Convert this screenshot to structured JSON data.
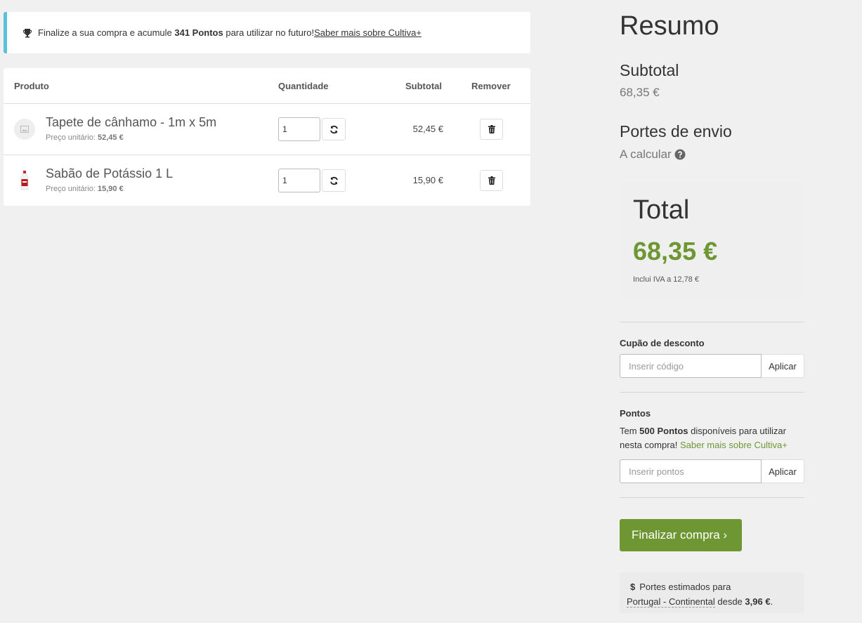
{
  "notice": {
    "icon": "trophy-icon",
    "text_before": "Finalize a sua compra e acumule ",
    "points_bold": "341 Pontos",
    "text_after": " para utilizar no futuro! ",
    "link": "Saber mais sobre Cultiva+"
  },
  "cart": {
    "headers": {
      "product": "Produto",
      "quantity": "Quantidade",
      "subtotal": "Subtotal",
      "remove": "Remover"
    },
    "items": [
      {
        "name": "Tapete de cânhamo - 1m x 5m",
        "unit_label": "Preço unitário: ",
        "unit_price": "52,45 €",
        "quantity": "1",
        "subtotal": "52,45 €",
        "thumb": "image-placeholder-icon"
      },
      {
        "name": "Sabão de Potássio 1 L",
        "unit_label": "Preço unitário: ",
        "unit_price": "15,90 €",
        "quantity": "1",
        "subtotal": "15,90 €",
        "thumb": "bottle-icon"
      }
    ]
  },
  "summary": {
    "title": "Resumo",
    "subtotal_label": "Subtotal",
    "subtotal_value": "68,35 €",
    "shipping_label": "Portes de envio",
    "shipping_value": "A calcular",
    "total_label": "Total",
    "total_value": "68,35 €",
    "vat_note": "Inclui IVA a 12,78 €",
    "coupon": {
      "label": "Cupão de desconto",
      "placeholder": "Inserir código",
      "button": "Aplicar"
    },
    "points": {
      "label": "Pontos",
      "text_before": "Tem ",
      "points_bold": "500 Pontos",
      "text_after": " disponíveis para utilizar nesta compra! ",
      "link": "Saber mais sobre Cultiva+",
      "placeholder": "Inserir pontos",
      "button": "Aplicar"
    },
    "checkout_button": "Finalizar compra ›",
    "shipping_estimate": {
      "text_before": "Portes estimados para",
      "destination": "Portugal - Continental",
      "text_mid": " desde ",
      "price": "3,96 €",
      "text_end": "."
    }
  },
  "colors": {
    "accent_green": "#6e9734",
    "notice_border": "#5bc0de",
    "background": "#f0f0f0"
  }
}
